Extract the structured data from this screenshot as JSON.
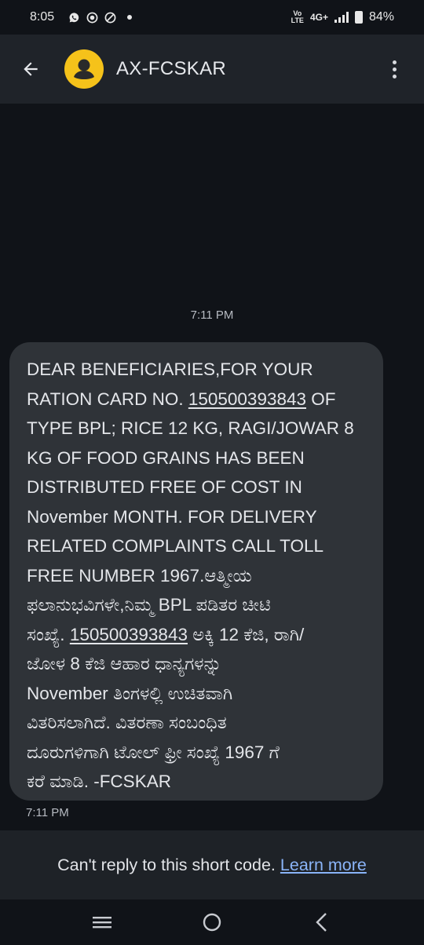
{
  "status_bar": {
    "time": "8:05",
    "network_type": "4G+",
    "volte_top": "Vo",
    "volte_bottom": "LTE",
    "battery": "84%"
  },
  "app_bar": {
    "contact_name": "AX-FCSKAR"
  },
  "conversation": {
    "time_header": "7:11 PM",
    "message": {
      "lines": [
        [
          "DEAR BENEFICIARIES,FOR YOUR"
        ],
        [
          "RATION CARD NO. ",
          "150500393843",
          " OF"
        ],
        [
          "TYPE BPL; RICE 12 KG, RAGI/JOWAR 8"
        ],
        [
          "KG OF FOOD GRAINS HAS BEEN"
        ],
        [
          "DISTRIBUTED FREE OF COST IN"
        ],
        [
          "November MONTH. FOR DELIVERY"
        ],
        [
          "RELATED COMPLAINTS CALL TOLL"
        ],
        [
          "FREE NUMBER 1967.ಆತ್ಮೀಯ"
        ],
        [
          "ಫಲಾನುಭವಿಗಳೇ,ನಿಮ್ಮ BPL ಪಡಿತರ ಚೀಟಿ"
        ],
        [
          "ಸಂಖ್ಯೆ. ",
          "150500393843",
          "  ಅಕ್ಕಿ 12 ಕೆಜಿ, ರಾಗಿ/"
        ],
        [
          "ಜೋಳ 8 ಕೆಜಿ ಆಹಾರ ಧಾನ್ಯಗಳನ್ನು"
        ],
        [
          "November ತಿಂಗಳಲ್ಲಿ ಉಚಿತವಾಗಿ"
        ],
        [
          "ವಿತರಿಸಲಾಗಿದೆ. ವಿತರಣಾ ಸಂಬಂಧಿತ"
        ],
        [
          "ದೂರುಗಳಿಗಾಗಿ ಟೋಲ್ ಫ್ರೀ ಸಂಖ್ಯೆ 1967 ಗೆ"
        ],
        [
          "ಕರೆ ಮಾಡಿ. -FCSKAR"
        ]
      ],
      "time": "7:11 PM"
    }
  },
  "reply_notice": {
    "text": "Can't reply to this short code.",
    "link_label": "Learn more"
  },
  "colors": {
    "background": "#101318",
    "app_bar": "#1f2329",
    "bubble": "#2f3338",
    "avatar": "#f5c21a",
    "link": "#8ab4f8"
  },
  "icons": [
    "whatsapp-icon",
    "record-icon",
    "blocked-icon",
    "back-arrow-icon",
    "person-icon",
    "more-vert-icon",
    "recents-icon",
    "home-icon",
    "nav-back-icon"
  ]
}
